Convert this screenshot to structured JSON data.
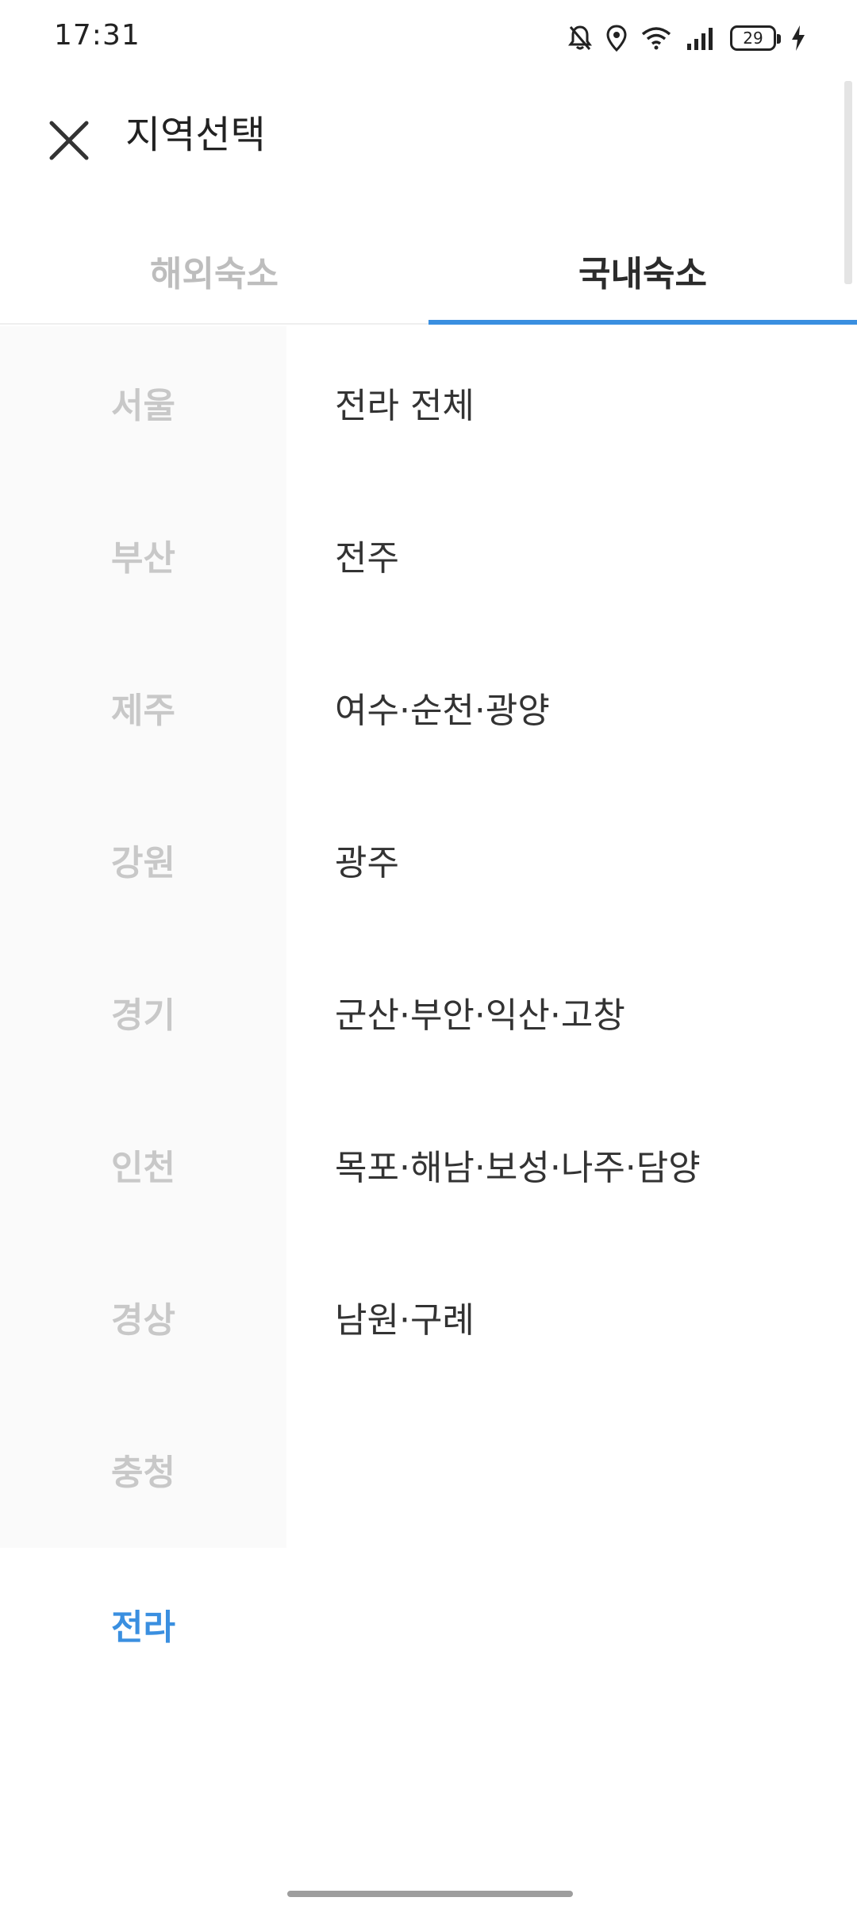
{
  "status_bar": {
    "time": "17:31",
    "battery_level": "29",
    "icons": [
      "mute-bell-icon",
      "location-icon",
      "wifi-icon",
      "signal-icon",
      "battery-icon",
      "charging-icon"
    ]
  },
  "header": {
    "close_icon": "close-icon",
    "title": "지역선택"
  },
  "tabs": [
    {
      "label": "해외숙소",
      "active": false
    },
    {
      "label": "국내숙소",
      "active": true
    }
  ],
  "regions": [
    {
      "label": "서울",
      "selected": false
    },
    {
      "label": "부산",
      "selected": false
    },
    {
      "label": "제주",
      "selected": false
    },
    {
      "label": "강원",
      "selected": false
    },
    {
      "label": "경기",
      "selected": false
    },
    {
      "label": "인천",
      "selected": false
    },
    {
      "label": "경상",
      "selected": false
    },
    {
      "label": "충청",
      "selected": false
    },
    {
      "label": "전라",
      "selected": true
    }
  ],
  "sub_regions": [
    {
      "label": "전라 전체"
    },
    {
      "label": "전주"
    },
    {
      "label": "여수·순천·광양"
    },
    {
      "label": "광주"
    },
    {
      "label": "군산·부안·익산·고창"
    },
    {
      "label": "목포·해남·보성·나주·담양"
    },
    {
      "label": "남원·구례"
    }
  ],
  "colors": {
    "accent": "#3a8fe0",
    "inactive_text": "#c8c8c8",
    "panel_bg": "#fafafa"
  }
}
